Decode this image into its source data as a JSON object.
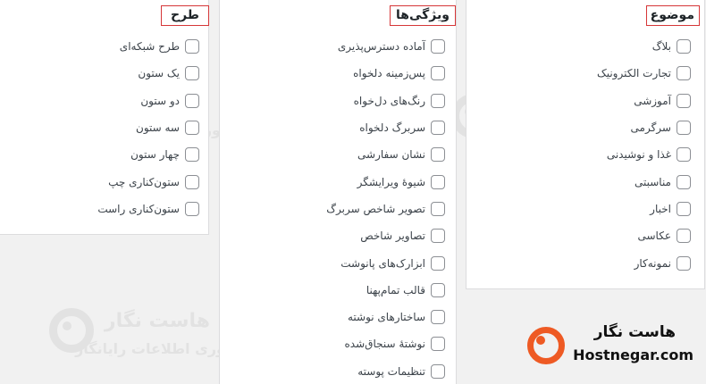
{
  "panels": {
    "topic": {
      "title": "موضوع",
      "options": [
        "بلاگ",
        "تجارت الکترونیک",
        "آموزشی",
        "سرگرمی",
        "غذا و نوشیدنی",
        "مناسبتی",
        "اخبار",
        "عکاسی",
        "نمونه‌کار"
      ]
    },
    "features": {
      "title": "ویژگی‌ها",
      "options": [
        "آماده دسترس‌پذیری",
        "پس‌زمینه دلخواه",
        "رنگ‌های دل‌خواه",
        "سربرگ دلخواه",
        "نشان سفارشی",
        "شیوهٔ ویرایشگر",
        "تصویر شاخص سربرگ",
        "تصاویر شاخص",
        "ابزارک‌های پانوشت",
        "قالب تمام‌پهنا",
        "ساختارهای نوشته",
        "نوشتهٔ سنجاق‌شده",
        "تنظیمات پوسته"
      ]
    },
    "layout": {
      "title": "طرح",
      "options": [
        "طرح شبکه‌ای",
        "یک ستون",
        "دو ستون",
        "سه ستون",
        "چهار ستون",
        "ستون‌کناری چپ",
        "ستون‌کناری راست"
      ]
    }
  },
  "watermark": {
    "name": "هاست نگار",
    "tagline": "فناوری اطلاعات رایانگار"
  },
  "brand_logo": {
    "name_fa": "هاست نگار",
    "name_en": "Hostnegar.com",
    "accent_color": "#ee5a24"
  }
}
